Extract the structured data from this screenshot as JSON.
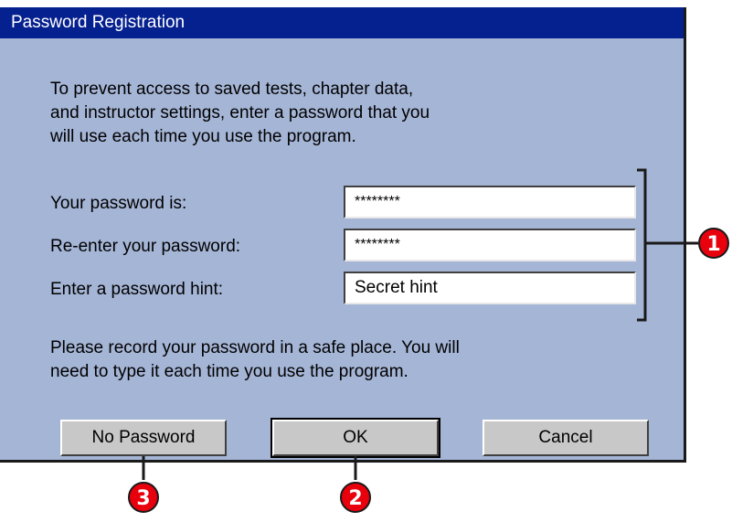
{
  "window": {
    "title": "Password Registration"
  },
  "intro_text": "To prevent access to saved tests, chapter data,\nand instructor settings, enter a password that you\nwill use each time you use the program.",
  "fields": [
    {
      "label": "Your password is:",
      "value": "********"
    },
    {
      "label": "Re-enter your password:",
      "value": "********"
    },
    {
      "label": "Enter a password hint:",
      "value": "Secret hint"
    }
  ],
  "note_text": "Please record your password in a safe place. You will\nneed to type it each time you use the program.",
  "buttons": {
    "no_password": "No Password",
    "ok": "OK",
    "cancel": "Cancel"
  },
  "callouts": [
    "1",
    "2",
    "3"
  ],
  "colors": {
    "dialog_bg": "#a5b5d6",
    "titlebar": "#05208f",
    "button": "#c8c8c8",
    "callout": "#e8000d"
  }
}
